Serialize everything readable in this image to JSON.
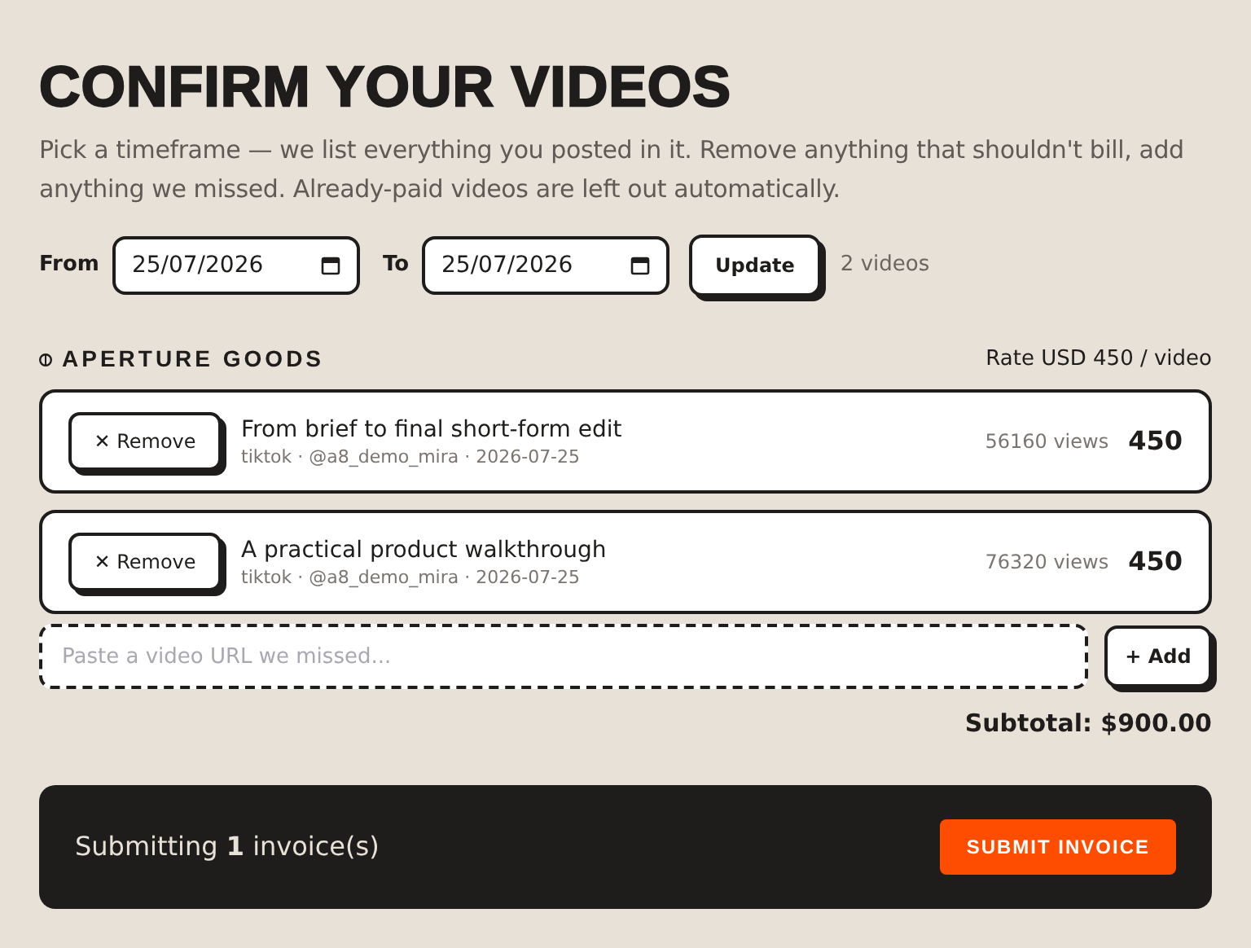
{
  "title": "CONFIRM YOUR VIDEOS",
  "intro": "Pick a timeframe — we list everything you posted in it. Remove anything that shouldn't bill, add anything we missed. Already-paid videos are left out automatically.",
  "range": {
    "from_label": "From",
    "from_value": "25/07/2026",
    "to_label": "To",
    "to_value": "25/07/2026",
    "button": "Update",
    "count": "2 videos"
  },
  "brand": {
    "name": "APERTURE GOODS",
    "rate": "Rate USD 450 / video"
  },
  "videos": [
    {
      "remove": "✕ Remove",
      "title": "From brief to final short-form edit",
      "meta": "tiktok · @a8_demo_mira · 2026-07-25",
      "views": "56160 views",
      "amount": "450"
    },
    {
      "remove": "✕ Remove",
      "title": "A practical product walkthrough",
      "meta": "tiktok · @a8_demo_mira · 2026-07-25",
      "views": "76320 views",
      "amount": "450"
    }
  ],
  "add": {
    "placeholder": "Paste a video URL we missed...",
    "button": "+ Add"
  },
  "subtotal": "Subtotal: $900.00",
  "footer": {
    "text": "Submitting **1** invoice(s)",
    "button": "SUBMIT INVOICE"
  }
}
